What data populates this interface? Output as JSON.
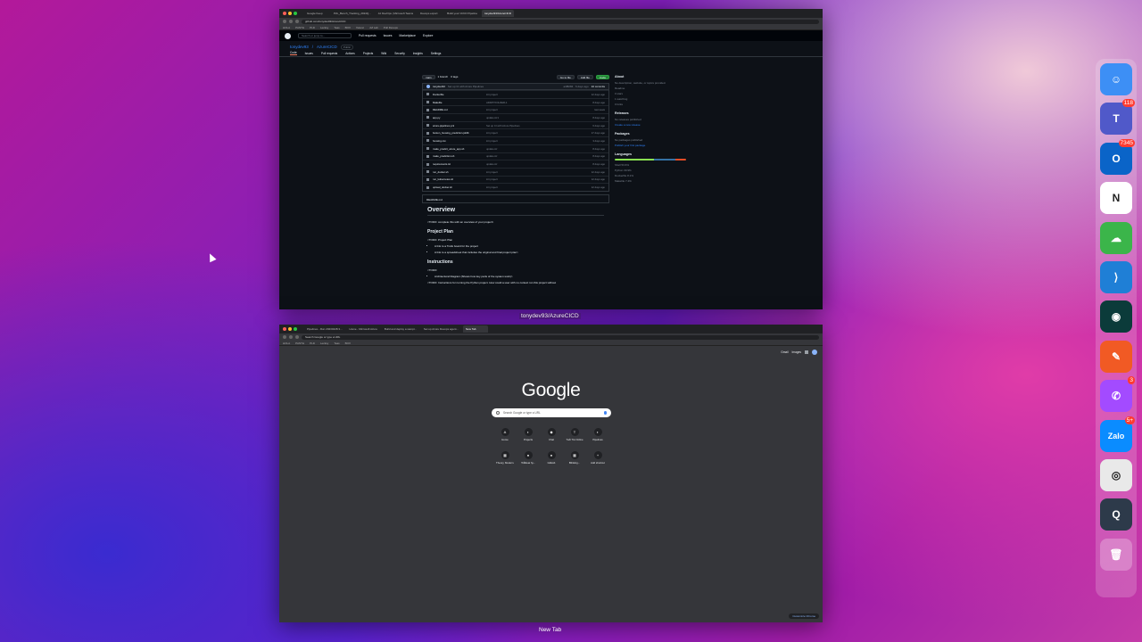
{
  "top_window": {
    "tabs": [
      "Google Keep",
      "P2L_Bench_Tracking_2024Q...",
      "Az DevOps | Microsoft Teams",
      "Devops export",
      "Build your CI/CD Pipeline",
      "tonydev93/AzureCICD"
    ],
    "url": "github.com/tonydev93/AzureCICD",
    "bookmarks": [
      "HOLA",
      "PANTH",
      "PLD",
      "Lecksy",
      "Teas",
      "BOX",
      "Xelenc",
      "AZ Lab",
      "Pull Devops"
    ],
    "header": {
      "search_placeholder": "Search or jump to...",
      "links": [
        "Pull requests",
        "Issues",
        "Marketplace",
        "Explore"
      ]
    },
    "repo": {
      "owner": "tonydev93",
      "name": "AzureCICD",
      "visibility": "Public"
    },
    "repo_nav": [
      "Code",
      "Issues",
      "Pull requests",
      "Actions",
      "Projects",
      "Wiki",
      "Security",
      "Insights",
      "Settings"
    ],
    "toolbar": {
      "branch": "main",
      "branches": "1 branch",
      "tags": "0 tags",
      "goto": "Go to file",
      "add": "Add file",
      "code": "Code"
    },
    "commit": {
      "author": "tonydev93",
      "message": "Set up CI with Azure Pipelines",
      "info": "a4f8284 · 6 days ago",
      "count": "10 commits"
    },
    "files": [
      {
        "name": "Dockerfile",
        "msg": "init project",
        "time": "12 days ago"
      },
      {
        "name": "Makefile",
        "msg": "ADDPYFOLDER-1",
        "time": "8 days ago"
      },
      {
        "name": "README.md",
        "msg": "init project",
        "time": "last week"
      },
      {
        "name": "app.py",
        "msg": "update Az1",
        "time": "8 days ago"
      },
      {
        "name": "azure-pipelines.yml",
        "msg": "Set up CI with Azure Pipelines",
        "time": "6 days ago"
      },
      {
        "name": "boston_housing_prediction.joblib",
        "msg": "init project",
        "time": "17 days ago"
      },
      {
        "name": "housing.csv",
        "msg": "init project",
        "time": "3 days ago"
      },
      {
        "name": "make_predict_azure_app.sh",
        "msg": "update Az",
        "time": "8 days ago"
      },
      {
        "name": "make_prediction.sh",
        "msg": "update Az",
        "time": "8 days ago"
      },
      {
        "name": "requirements.txt",
        "msg": "update Az",
        "time": "8 days ago"
      },
      {
        "name": "run_docker.sh",
        "msg": "init project",
        "time": "12 days ago"
      },
      {
        "name": "run_kubernetes.sh",
        "msg": "init project",
        "time": "12 days ago"
      },
      {
        "name": "upload_docker.sh",
        "msg": "init project",
        "time": "12 days ago"
      }
    ],
    "readme_label": "README.md",
    "readme": {
      "h_overview": "Overview",
      "p_overview": "<TODO: complete this with an overview of your project>",
      "h_plan": "Project Plan",
      "p_plan": "<TODO: Project Plan",
      "li_plan_1": "A link to a Trello board for the project",
      "li_plan_2": "A link to a spreadsheet that includes the original and final project plan>",
      "h_instr": "Instructions",
      "p_instr": "<TODO:",
      "li_instr_1": "Architectural Diagram (Shows how key parts of the system work)>",
      "p_instr_2": "<TODO: Instructions for running the Python project. How could a user with no context run this project without"
    },
    "sidebar": {
      "about": "About",
      "desc": "No description, website, or topics provided.",
      "readme": "Readme",
      "stars": "0 stars",
      "watching": "1 watching",
      "forks": "0 forks",
      "releases": "Releases",
      "releases_desc": "No releases published",
      "releases_link": "Create a new release",
      "packages": "Packages",
      "packages_desc": "No packages published",
      "packages_link": "Publish your first package",
      "languages": "Languages",
      "langs": [
        "Shell 53.6%",
        "Python 30.9%",
        "Dockerfile 8.1%",
        "Makefile 7.4%"
      ]
    }
  },
  "top_label": "tonydev93/AzureCICD",
  "bottom_window": {
    "tabs": [
      "Pipelines - Run 20230428.3...",
      "Home - Microsoft Azure",
      "Build and deploy a sampl...",
      "Set up Azure Devops agent...",
      "New Tab"
    ],
    "url": "Search Google or type a URL",
    "top_links": [
      "Gmail",
      "Images"
    ],
    "logo": "Google",
    "search_placeholder": "Search Google or type a URL",
    "shortcuts_row1": [
      {
        "label": "Home",
        "glyph": "A"
      },
      {
        "label": "Projects",
        "glyph": "◐"
      },
      {
        "label": "Chat",
        "glyph": "◆"
      },
      {
        "label": "Tuổi Trẻ Online",
        "glyph": "T"
      },
      {
        "label": "Pipelines",
        "glyph": "◐"
      }
    ],
    "shortcuts_row2": [
      {
        "label": "Theory, Modern...",
        "glyph": "▦"
      },
      {
        "label": "TrắIkuai hy...",
        "glyph": "●"
      },
      {
        "label": "GitHub",
        "glyph": "●"
      },
      {
        "label": "Blinking...",
        "glyph": "▦"
      },
      {
        "label": "Add shortcut",
        "glyph": "+"
      }
    ],
    "customize": "Customize Chrome"
  },
  "bottom_label": "New Tab",
  "dock": [
    {
      "name": "finder",
      "glyph": "☺",
      "color": "#3d8ff5"
    },
    {
      "name": "teams",
      "glyph": "T",
      "color": "#5059c9",
      "badge": "118"
    },
    {
      "name": "outlook",
      "glyph": "O",
      "color": "#0a64c8",
      "badge": "7345"
    },
    {
      "name": "notion",
      "glyph": "N",
      "color": "#ffffff"
    },
    {
      "name": "cloud-app",
      "glyph": "☁",
      "color": "#3bb54a"
    },
    {
      "name": "vscode",
      "glyph": "⟩",
      "color": "#1f7fd6"
    },
    {
      "name": "gitkraken",
      "glyph": "◉",
      "color": "#0b3b3a"
    },
    {
      "name": "pen-app",
      "glyph": "✎",
      "color": "#f15a24"
    },
    {
      "name": "messenger",
      "glyph": "✆",
      "color": "#a34bff",
      "badge": "3"
    },
    {
      "name": "zalo",
      "glyph": "Zalo",
      "color": "#0a8cff",
      "badge": "5+"
    },
    {
      "name": "chrome",
      "glyph": "◎",
      "color": "#e9e9e9"
    },
    {
      "name": "quicktime",
      "glyph": "Q",
      "color": "#2d3a4a"
    },
    {
      "name": "trash",
      "glyph": "🗑",
      "color": "rgba(255,255,255,0.25)"
    }
  ]
}
